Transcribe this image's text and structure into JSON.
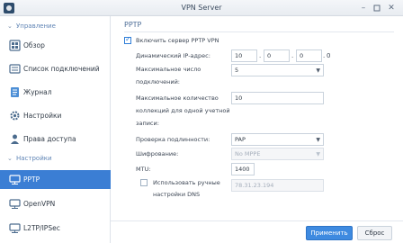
{
  "window": {
    "title": "VPN Server",
    "icons": {
      "app": "vpn-server-icon",
      "minimize": "minimize-icon",
      "maximize": "maximize-icon",
      "close": "close-icon"
    }
  },
  "sidebar": {
    "sections": [
      {
        "title": "Управление",
        "items": [
          {
            "label": "Обзор",
            "icon": "overview-icon",
            "active": false
          },
          {
            "label": "Список подключений",
            "icon": "connection-list-icon",
            "active": false
          },
          {
            "label": "Журнал",
            "icon": "log-icon",
            "active": false
          },
          {
            "label": "Настройки",
            "icon": "settings-gear-icon",
            "active": false
          },
          {
            "label": "Права доступа",
            "icon": "user-permissions-icon",
            "active": false
          }
        ]
      },
      {
        "title": "Настройки",
        "items": [
          {
            "label": "PPTP",
            "icon": "pptp-network-icon",
            "active": true
          },
          {
            "label": "OpenVPN",
            "icon": "openvpn-network-icon",
            "active": false
          },
          {
            "label": "L2TP/IPSec",
            "icon": "l2tp-network-icon",
            "active": false
          }
        ]
      }
    ]
  },
  "main": {
    "section_title": "PPTP",
    "enable_checkbox": {
      "label": "Включить сервер PPTP VPN",
      "checked": true
    },
    "dynamic_ip": {
      "label": "Динамический IP-адрес:",
      "octets": [
        "10",
        "0",
        "0",
        "0"
      ]
    },
    "max_connections": {
      "label_line1": "Максимальное число",
      "label_line2": "подключений:",
      "value": "5"
    },
    "max_per_account": {
      "label_line1": "Максимальное количество",
      "label_line2": "коллекций для одной учетной",
      "label_line3": "записи:",
      "value": "10"
    },
    "auth": {
      "label": "Проверка подлинности:",
      "value": "PAP"
    },
    "encryption": {
      "label": "Шифрование:",
      "value": "No MPPE",
      "disabled": true
    },
    "mtu": {
      "label": "MTU:",
      "value": "1400"
    },
    "manual_dns": {
      "label_line1": "Использовать ручные",
      "label_line2": "настройки DNS",
      "checked": false,
      "value": "78.31.23.194"
    }
  },
  "footer": {
    "apply_label": "Применить",
    "reset_label": "Сброс"
  },
  "colors": {
    "accent": "#3b7ed4",
    "button_primary": "#3e8ae0",
    "section_header": "#5f84b5"
  }
}
